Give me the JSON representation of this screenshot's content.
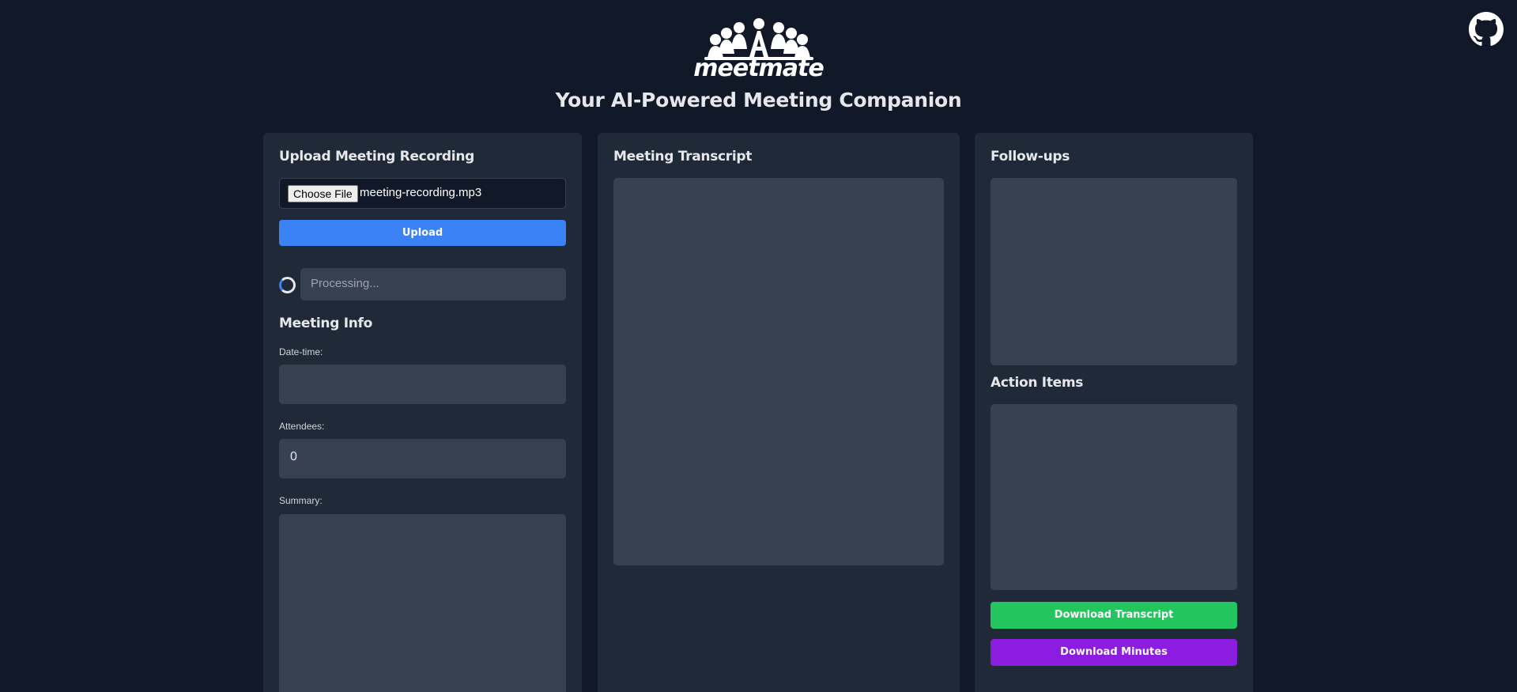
{
  "app": {
    "logo_text": "meetmate",
    "tagline": "Your AI-Powered Meeting Companion"
  },
  "icons": {
    "github": "github-icon",
    "logo": "meeting-people-logo-icon",
    "spinner": "loading-spinner-icon"
  },
  "upload": {
    "title": "Upload Meeting Recording",
    "choose_file_label": "Choose File",
    "file_name": "meeting-recording.mp3",
    "upload_label": "Upload",
    "status_text": "Processing..."
  },
  "meeting_info": {
    "title": "Meeting Info",
    "datetime_label": "Date-time:",
    "datetime_value": "",
    "attendees_label": "Attendees:",
    "attendees_value": "0",
    "summary_label": "Summary:",
    "summary_value": ""
  },
  "transcript": {
    "title": "Meeting Transcript",
    "content": ""
  },
  "followups": {
    "title": "Follow-ups",
    "content": ""
  },
  "action_items": {
    "title": "Action Items",
    "content": ""
  },
  "downloads": {
    "transcript_label": "Download Transcript",
    "minutes_label": "Download Minutes"
  },
  "colors": {
    "background": "#111827",
    "panel": "#1f2937",
    "field": "#374151",
    "upload_button": "#3b82f6",
    "download_transcript_button": "#22c55e",
    "download_minutes_button": "#8b1ce0"
  }
}
